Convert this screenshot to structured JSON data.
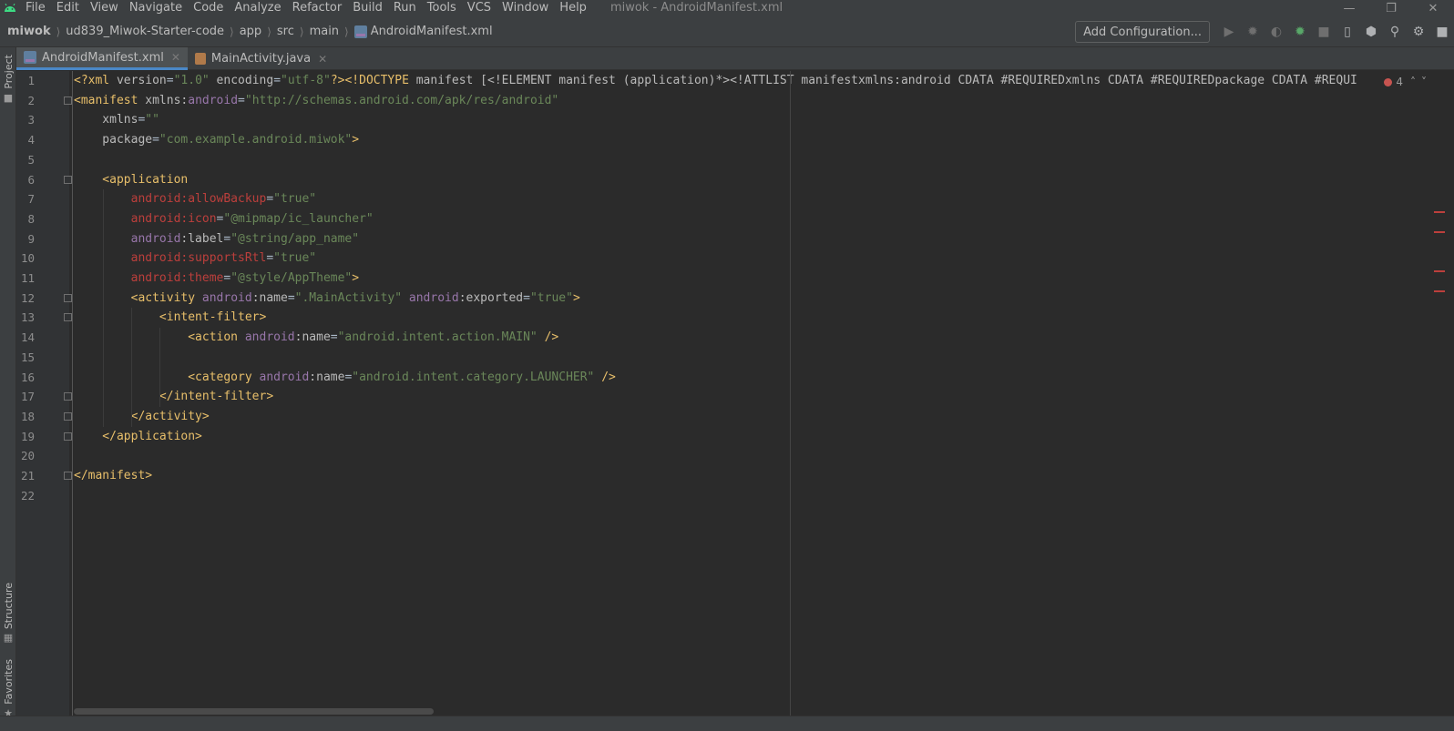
{
  "menubar": {
    "items": [
      "File",
      "Edit",
      "View",
      "Navigate",
      "Code",
      "Analyze",
      "Refactor",
      "Build",
      "Run",
      "Tools",
      "VCS",
      "Window",
      "Help"
    ],
    "window_title": "miwok - AndroidManifest.xml"
  },
  "breadcrumb": {
    "items": [
      "miwok",
      "ud839_Miwok-Starter-code",
      "app",
      "src",
      "main",
      "AndroidManifest.xml"
    ]
  },
  "toolbar": {
    "add_config_label": "Add Configuration..."
  },
  "left_strip": {
    "project_label": "Project",
    "structure_label": "Structure",
    "favorites_label": "Favorites"
  },
  "tabs": [
    {
      "label": "AndroidManifest.xml",
      "active": true
    },
    {
      "label": "MainActivity.java",
      "active": false
    }
  ],
  "editor": {
    "error_count": "4",
    "line_numbers": [
      "1",
      "2",
      "3",
      "4",
      "5",
      "6",
      "7",
      "8",
      "9",
      "10",
      "11",
      "12",
      "13",
      "14",
      "15",
      "16",
      "17",
      "18",
      "19",
      "20",
      "21",
      "22"
    ],
    "lines": [
      [
        [
          "t-tag",
          "<?xml "
        ],
        [
          "t-attr",
          "version"
        ],
        [
          "t-text",
          "="
        ],
        [
          "t-val",
          "\"1.0\""
        ],
        [
          "t-attr",
          " encoding"
        ],
        [
          "t-text",
          "="
        ],
        [
          "t-val",
          "\"utf-8\""
        ],
        [
          "t-tag",
          "?><!DOCTYPE "
        ],
        [
          "t-attr",
          "manifest [<!ELEMENT manifest (application)*><!ATTLIST manifestxmlns:android CDATA #REQUIREDxmlns CDATA #REQUIREDpackage CDATA #REQUI"
        ]
      ],
      [
        [
          "t-tag",
          "<manifest "
        ],
        [
          "t-attr",
          "xmlns:"
        ],
        [
          "t-ns",
          "android"
        ],
        [
          "t-text",
          "="
        ],
        [
          "t-val",
          "\"http://schemas.android.com/apk/res/android\""
        ]
      ],
      [
        [
          "t-attr",
          "    xmlns"
        ],
        [
          "t-text",
          "="
        ],
        [
          "t-val",
          "\"\""
        ]
      ],
      [
        [
          "t-attr",
          "    package"
        ],
        [
          "t-text",
          "="
        ],
        [
          "t-val",
          "\"com.example.android.miwok\""
        ],
        [
          "t-tag",
          ">"
        ]
      ],
      [],
      [
        [
          "t-tag",
          "    <application"
        ]
      ],
      [
        [
          "t-err",
          "        android:allowBackup"
        ],
        [
          "t-text",
          "="
        ],
        [
          "t-val",
          "\"true\""
        ]
      ],
      [
        [
          "t-err",
          "        android:icon"
        ],
        [
          "t-text",
          "="
        ],
        [
          "t-val",
          "\"@mipmap/ic_launcher\""
        ]
      ],
      [
        [
          "t-ns",
          "        android"
        ],
        [
          "t-attr",
          ":label"
        ],
        [
          "t-text",
          "="
        ],
        [
          "t-val",
          "\"@string/app_name\""
        ]
      ],
      [
        [
          "t-err",
          "        android:supportsRtl"
        ],
        [
          "t-text",
          "="
        ],
        [
          "t-val",
          "\"true\""
        ]
      ],
      [
        [
          "t-err",
          "        android:theme"
        ],
        [
          "t-text",
          "="
        ],
        [
          "t-val",
          "\"@style/AppTheme\""
        ],
        [
          "t-tag",
          ">"
        ]
      ],
      [
        [
          "t-tag",
          "        <activity "
        ],
        [
          "t-ns",
          "android"
        ],
        [
          "t-attr",
          ":name"
        ],
        [
          "t-text",
          "="
        ],
        [
          "t-val",
          "\".MainActivity\""
        ],
        [
          "t-text",
          " "
        ],
        [
          "t-ns",
          "android"
        ],
        [
          "t-attr",
          ":exported"
        ],
        [
          "t-text",
          "="
        ],
        [
          "t-val",
          "\"true\""
        ],
        [
          "t-tag",
          ">"
        ]
      ],
      [
        [
          "t-tag",
          "            <intent-filter>"
        ]
      ],
      [
        [
          "t-tag",
          "                <action "
        ],
        [
          "t-ns",
          "android"
        ],
        [
          "t-attr",
          ":name"
        ],
        [
          "t-text",
          "="
        ],
        [
          "t-val",
          "\"android.intent.action.MAIN\""
        ],
        [
          "t-tag",
          " />"
        ]
      ],
      [],
      [
        [
          "t-tag",
          "                <category "
        ],
        [
          "t-ns",
          "android"
        ],
        [
          "t-attr",
          ":name"
        ],
        [
          "t-text",
          "="
        ],
        [
          "t-val",
          "\"android.intent.category.LAUNCHER\""
        ],
        [
          "t-tag",
          " />"
        ]
      ],
      [
        [
          "t-tag",
          "            </intent-filter>"
        ]
      ],
      [
        [
          "t-tag",
          "        </activity>"
        ]
      ],
      [
        [
          "t-tag",
          "    </application>"
        ]
      ],
      [],
      [
        [
          "t-tag",
          "</manifest>"
        ]
      ],
      []
    ]
  },
  "colors": {
    "background": "#2b2b2b",
    "tag": "#e8bf6a",
    "attribute": "#bababa",
    "namespace": "#9876aa",
    "value": "#6a8759",
    "error": "#bc3f3c"
  }
}
